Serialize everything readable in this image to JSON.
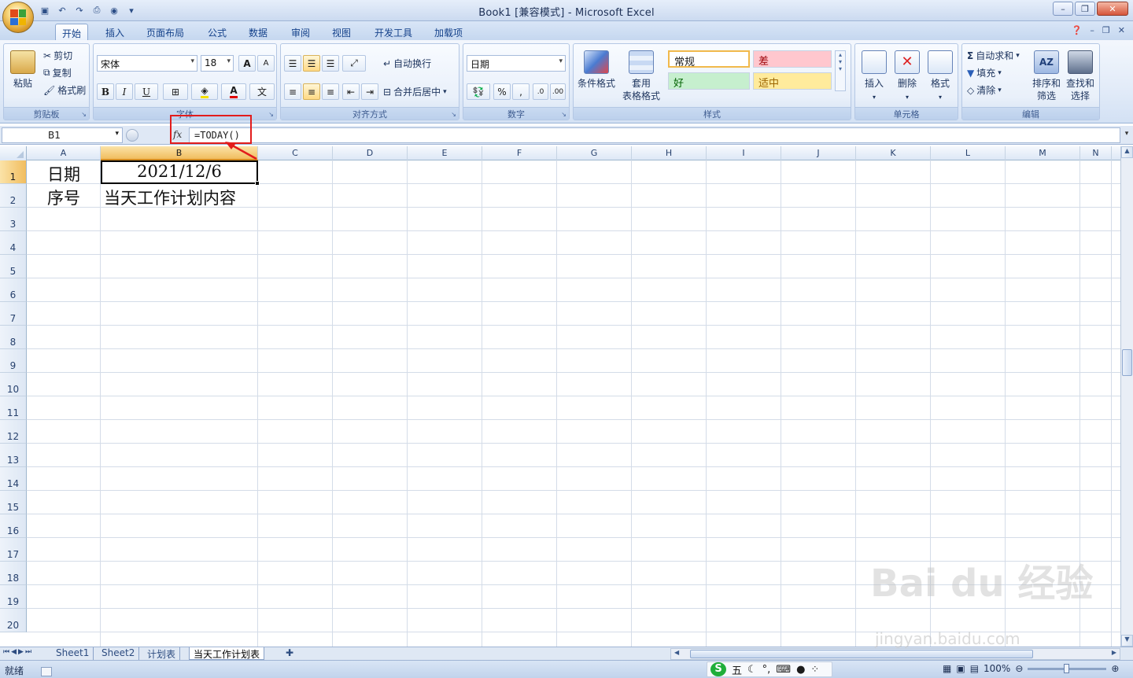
{
  "window": {
    "title": "Book1  [兼容模式] - Microsoft Excel",
    "controls": [
      "–",
      "❐",
      "✕"
    ]
  },
  "tabs": [
    "开始",
    "插入",
    "页面布局",
    "公式",
    "数据",
    "审阅",
    "视图",
    "开发工具",
    "加载项"
  ],
  "ribbon": {
    "clipboard": {
      "paste": "粘贴",
      "cut": "剪切",
      "copy": "复制",
      "format_painter": "格式刷",
      "label": "剪贴板"
    },
    "font": {
      "name": "宋体",
      "size": "18",
      "label": "字体",
      "bold": "B",
      "italic": "I",
      "underline": "U",
      "grow": "A",
      "shrink": "A"
    },
    "alignment": {
      "wrap": "自动换行",
      "merge": "合并后居中",
      "label": "对齐方式"
    },
    "number": {
      "format": "日期",
      "percent": "%",
      "comma": ",",
      "label": "数字"
    },
    "styles": {
      "conditional": "条件格式",
      "table_line1": "套用",
      "table_line2": "表格格式",
      "normal": "常规",
      "bad": "差",
      "good": "好",
      "neutral": "适中",
      "label": "样式"
    },
    "cells": {
      "insert": "插入",
      "delete": "删除",
      "format": "格式",
      "label": "单元格"
    },
    "editing": {
      "autosum": "自动求和",
      "fill": "填充",
      "clear": "清除",
      "sort_line1": "排序和",
      "sort_line2": "筛选",
      "find_line1": "查找和",
      "find_line2": "选择",
      "label": "编辑"
    }
  },
  "formula_bar": {
    "name_box": "B1",
    "fx": "fx",
    "formula": "=TODAY()"
  },
  "columns": [
    "A",
    "B",
    "C",
    "D",
    "E",
    "F",
    "G",
    "H",
    "I",
    "J",
    "K",
    "L",
    "M",
    "N"
  ],
  "rows": [
    "1",
    "2",
    "3",
    "4",
    "5",
    "6",
    "7",
    "8",
    "9",
    "10",
    "11",
    "12",
    "13",
    "14",
    "15",
    "16",
    "17",
    "18",
    "19",
    "20"
  ],
  "cells": {
    "A1": "日期",
    "B1": "2021/12/6",
    "A2": "序号",
    "B2": "当天工作计划内容"
  },
  "sheets": [
    "Sheet1",
    "Sheet2",
    "计划表",
    "当天工作计划表"
  ],
  "active_sheet": "当天工作计划表",
  "status": {
    "ready": "就绪",
    "zoom": "100%",
    "ime": "五"
  },
  "watermark": {
    "brand": "Bai du 经验",
    "url": "jingyan.baidu.com"
  },
  "colors": {
    "accent": "#15428b",
    "selection": "#f1bd5f",
    "annotation": "#e21c1c"
  }
}
